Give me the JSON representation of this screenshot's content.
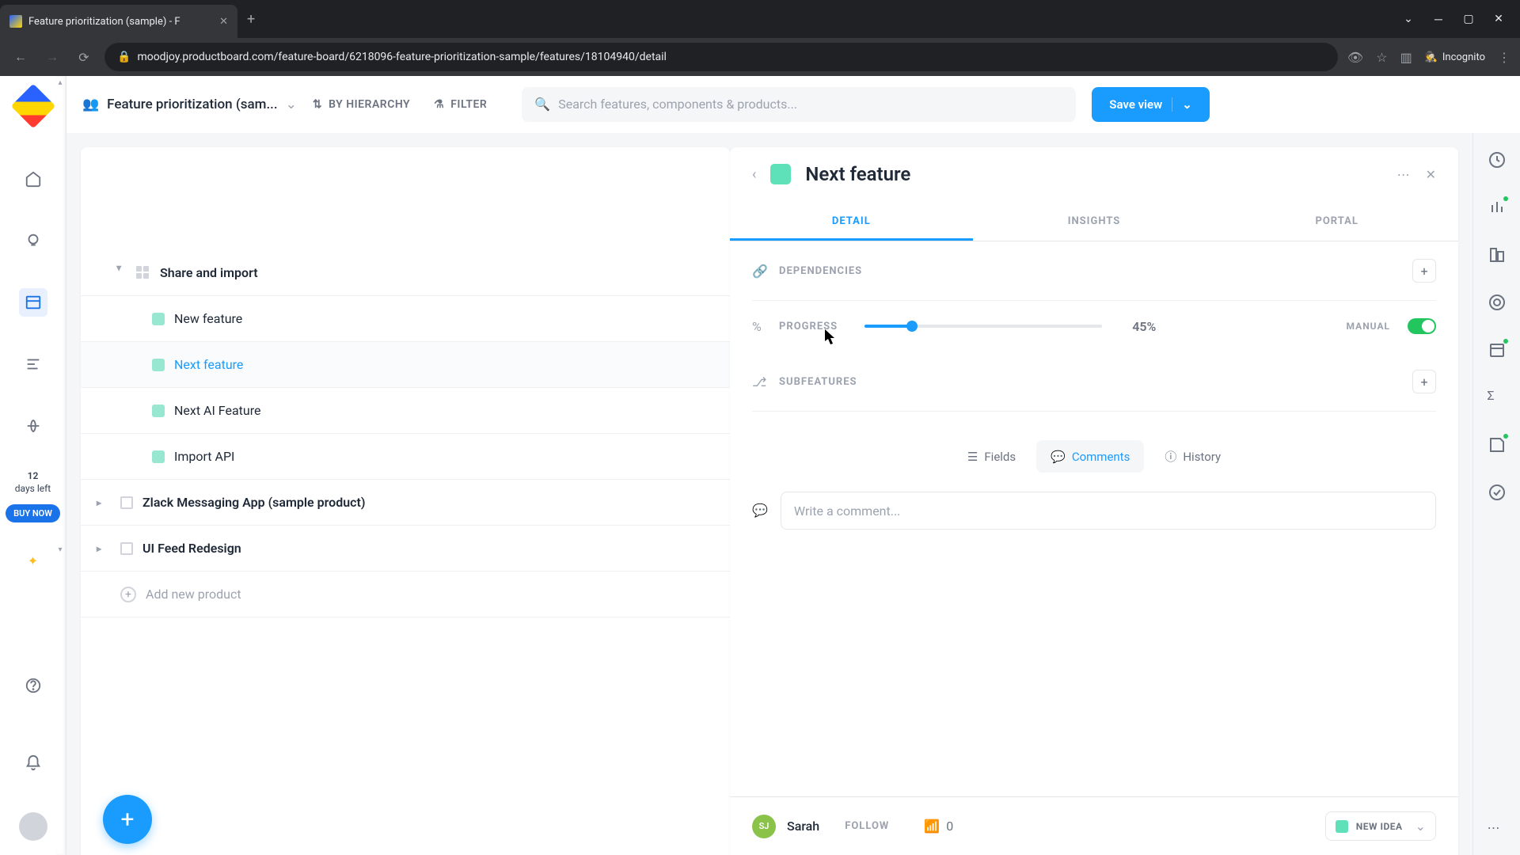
{
  "browser": {
    "tab_title": "Feature prioritization (sample) - F",
    "url": "moodjoy.productboard.com/feature-board/6218096-feature-prioritization-sample/features/18104940/detail",
    "incognito": "Incognito"
  },
  "topbar": {
    "board_name": "Feature prioritization (sam...",
    "hierarchy": "BY HIERARCHY",
    "filter": "FILTER",
    "search_placeholder": "Search features, components & products...",
    "save": "Save view"
  },
  "trial": {
    "days": "12",
    "label": "days left",
    "buy": "BUY NOW"
  },
  "tree": {
    "share_import": "Share and import",
    "new_feature": "New feature",
    "next_feature": "Next feature",
    "next_ai": "Next AI Feature",
    "import_api": "Import API",
    "zlack": "Zlack Messaging App (sample product)",
    "ui_feed": "UI Feed Redesign",
    "add_product": "Add new product"
  },
  "detail": {
    "title": "Next feature",
    "tabs": {
      "detail": "DETAIL",
      "insights": "INSIGHTS",
      "portal": "PORTAL"
    },
    "deps": "DEPENDENCIES",
    "progress": "PROGRESS",
    "progress_val": "45%",
    "manual": "MANUAL",
    "subfeatures": "SUBFEATURES",
    "seg": {
      "fields": "Fields",
      "comments": "Comments",
      "history": "History"
    },
    "comment_placeholder": "Write a comment...",
    "user": "Sarah",
    "user_initials": "SJ",
    "follow": "FOLLOW",
    "insights_count": "0",
    "status": "NEW IDEA"
  }
}
